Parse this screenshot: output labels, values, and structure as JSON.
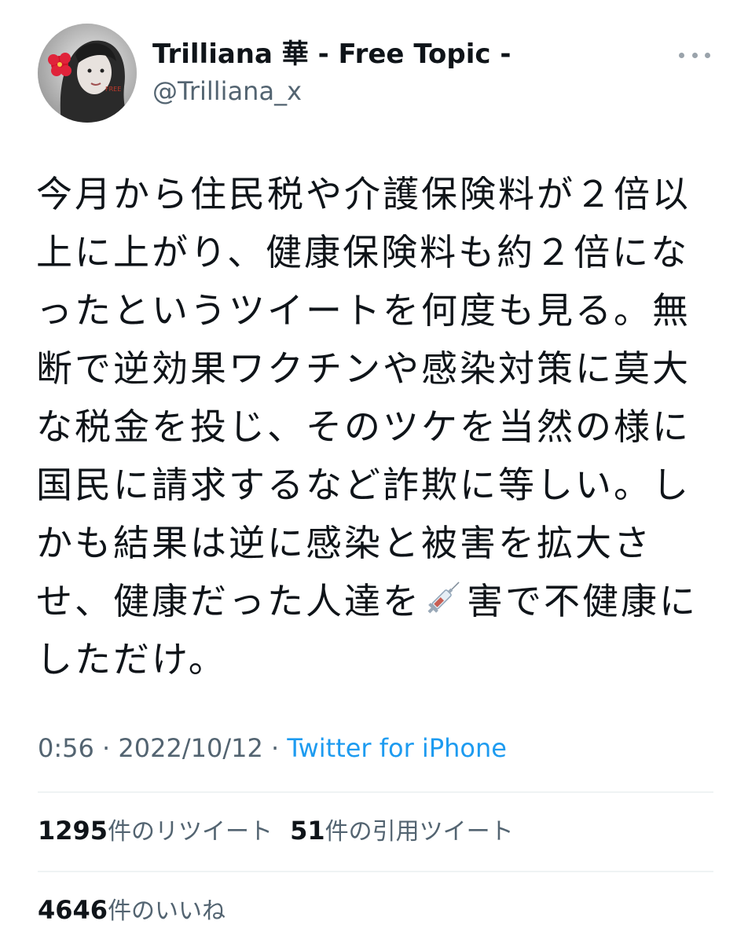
{
  "author": {
    "display_name": "Trilliana 華 - Free Topic -",
    "handle": "@Trilliana_x",
    "avatar": "avatar-photo"
  },
  "more_icon": "ellipsis-icon",
  "tweet": {
    "lines": [
      "今月から住民税や介護保険料が２倍以",
      "上に上がり、健康保険料も約２倍にな",
      "ったというツイートを何度も見る。無",
      "断で逆効果ワクチンや感染対策に莫大",
      "な税金を投じ、そのツケを当然の様に",
      "国民に請求するなど詐欺に等しい。し",
      "かも結果は逆に感染と被害を拡大さ"
    ],
    "line8_before": "せ、健康だった人達を",
    "line8_emoji": "syringe-emoji",
    "line8_after": "害で不健康に",
    "line9": "しただけ。"
  },
  "meta": {
    "time": "0:56",
    "sep1": " · ",
    "date": "2022/10/12",
    "sep2": " · ",
    "source": "Twitter for iPhone"
  },
  "stats": {
    "retweets_count": "1295",
    "retweets_label": "件のリツイート",
    "quotes_count": "51",
    "quotes_label": "件の引用ツイート",
    "likes_count": "4646",
    "likes_label": "件のいいね"
  },
  "colors": {
    "text": "#0f1419",
    "secondary": "#536471",
    "link": "#1d9bf0",
    "divider": "#eff3f4"
  }
}
